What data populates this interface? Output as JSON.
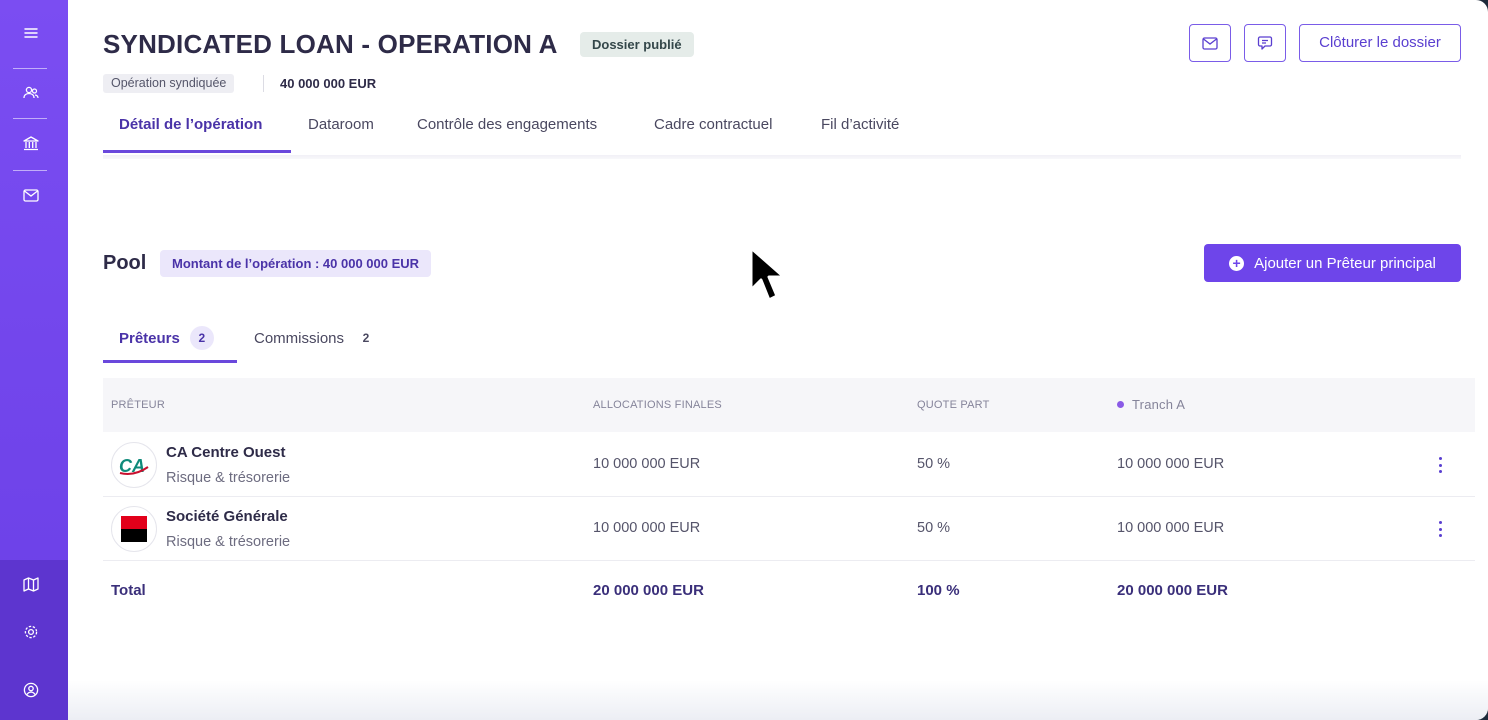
{
  "header": {
    "title": "SYNDICATED LOAN - OPERATION A",
    "status_badge": "Dossier publié",
    "operation_type": "Opération syndiquée",
    "amount": "40 000 000 EUR",
    "close_button": "Clôturer le dossier"
  },
  "main_tabs": [
    {
      "label": "Détail de l’opération",
      "active": true
    },
    {
      "label": "Dataroom"
    },
    {
      "label": "Contrôle des engagements"
    },
    {
      "label": "Cadre contractuel"
    },
    {
      "label": "Fil d’activité"
    }
  ],
  "pool": {
    "title": "Pool",
    "amount_badge": "Montant de l’opération : 40 000 000 EUR",
    "add_button": "Ajouter un Prêteur principal"
  },
  "sub_tabs": [
    {
      "label": "Prêteurs",
      "count": "2",
      "active": true
    },
    {
      "label": "Commissions",
      "count": "2"
    }
  ],
  "table": {
    "columns": [
      "PRÊTEUR",
      "ALLOCATIONS FINALES",
      "QUOTE PART",
      "Tranch A"
    ],
    "rows": [
      {
        "name": "CA Centre Ouest",
        "sub": "Risque & trésorerie",
        "allocation": "10 000 000 EUR",
        "share": "50 %",
        "tranche": "10 000 000 EUR",
        "logo": "ca-logo-icon"
      },
      {
        "name": "Société Générale",
        "sub": "Risque & trésorerie",
        "allocation": "10 000 000 EUR",
        "share": "50 %",
        "tranche": "10 000 000 EUR",
        "logo": "sg-logo-icon"
      }
    ],
    "total": {
      "label": "Total",
      "allocation": "20 000 000 EUR",
      "share": "100 %",
      "tranche": "20 000 000 EUR"
    }
  },
  "sidebar": {
    "icons": [
      "menu-icon",
      "users-icon",
      "bank-icon",
      "mail-icon",
      "map-icon",
      "settings-icon",
      "profile-icon"
    ]
  },
  "colors": {
    "accent": "#6e45ea",
    "sidebar": "#7b4df2",
    "tranche_dot": "#8a5ae6"
  }
}
